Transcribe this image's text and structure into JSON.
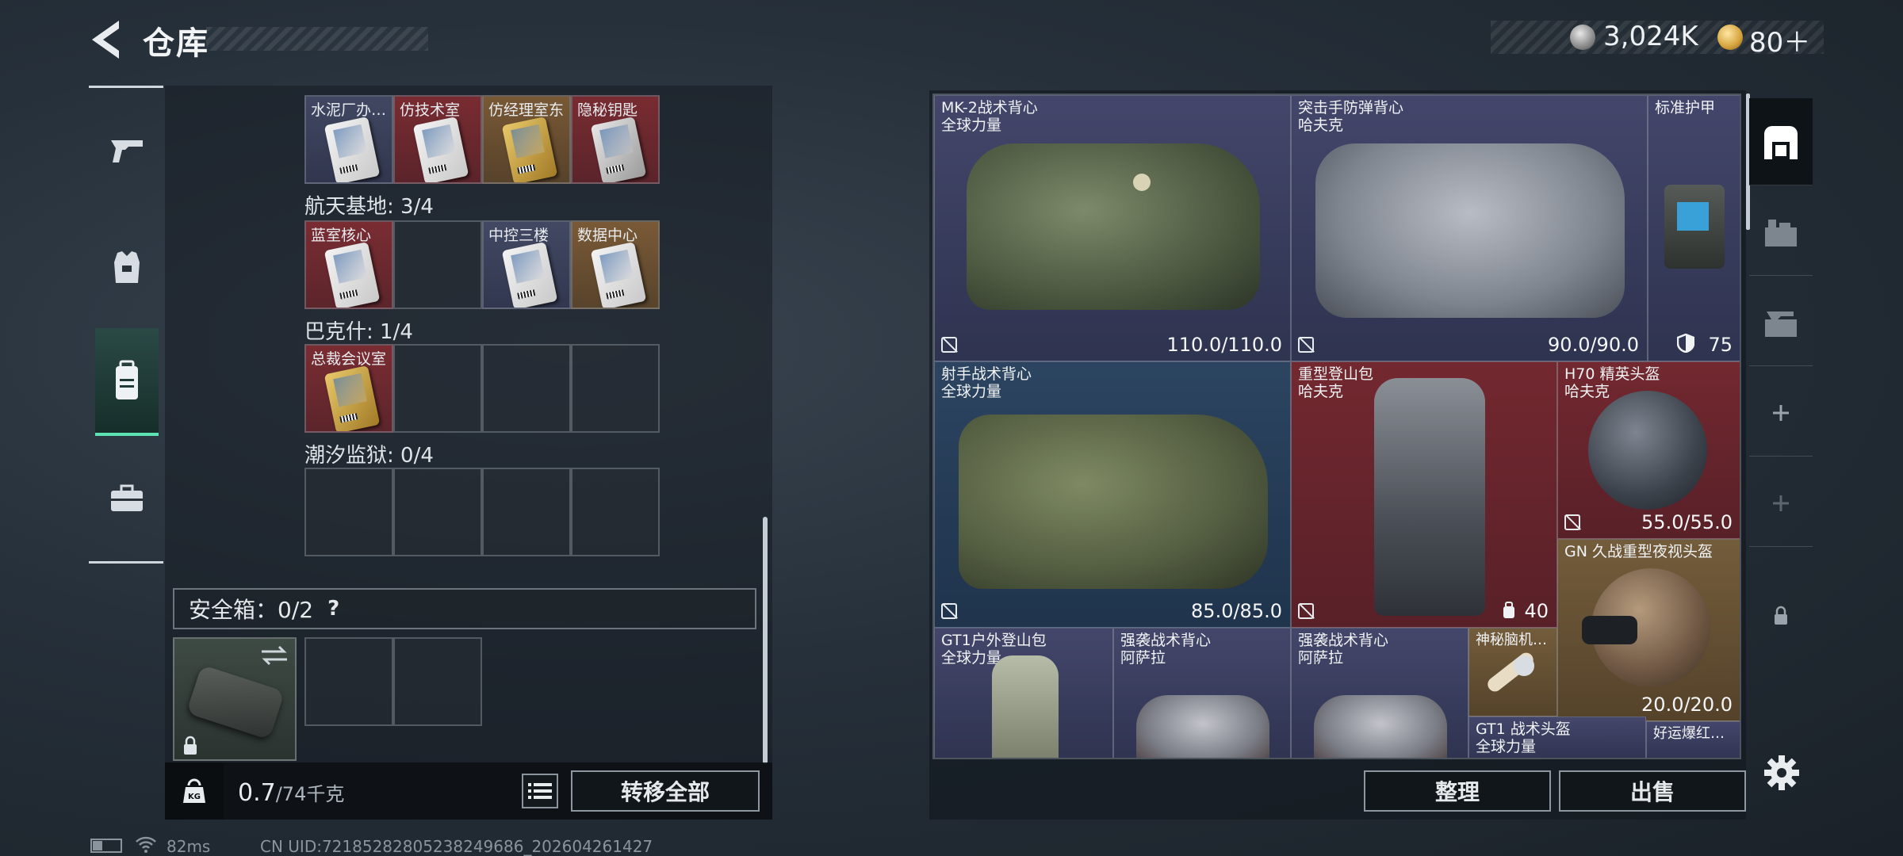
{
  "header": {
    "title": "仓库",
    "currency_silver": "3,024K",
    "currency_gold": "80＋"
  },
  "left_nav": {
    "items": [
      "weapon",
      "armor",
      "backpack",
      "toolbox"
    ],
    "active": "backpack"
  },
  "keycard_sections": [
    {
      "label": "",
      "cells": [
        {
          "label": "水泥厂办…",
          "rarity": "purple"
        },
        {
          "label": "仿技术室",
          "rarity": "red"
        },
        {
          "label": "仿经理室东",
          "rarity": "gold"
        },
        {
          "label": "隐秘钥匙",
          "rarity": "red"
        }
      ]
    },
    {
      "label": "航天基地: 3/4",
      "cells": [
        {
          "label": "蓝室核心",
          "rarity": "red"
        },
        {
          "label": "",
          "rarity": "empty"
        },
        {
          "label": "中控三楼",
          "rarity": "purple"
        },
        {
          "label": "数据中心",
          "rarity": "gold"
        }
      ]
    },
    {
      "label": "巴克什: 1/4",
      "cells": [
        {
          "label": "总裁会议室",
          "rarity": "red"
        },
        {
          "label": "",
          "rarity": "empty"
        },
        {
          "label": "",
          "rarity": "empty"
        },
        {
          "label": "",
          "rarity": "empty"
        }
      ]
    },
    {
      "label": "潮汐监狱: 0/4",
      "cells": [
        {
          "label": "",
          "rarity": "empty"
        },
        {
          "label": "",
          "rarity": "empty"
        },
        {
          "label": "",
          "rarity": "empty"
        },
        {
          "label": "",
          "rarity": "empty"
        }
      ]
    }
  ],
  "safe_box": {
    "label": "安全箱：0/2",
    "help": "?"
  },
  "capacity": {
    "current": "0.7",
    "max": "/74千克",
    "icon_label": "KG"
  },
  "buttons": {
    "transfer_all": "转移全部",
    "sort": "整理",
    "sell": "出售"
  },
  "inventory": {
    "mk2": {
      "name": "MK-2战术背心",
      "sub": "全球力量",
      "durability": "110.0/110.0",
      "rarity": "purple"
    },
    "assault": {
      "name": "突击手防弹背心",
      "sub": "哈夫克",
      "durability": "90.0/90.0",
      "rarity": "purple"
    },
    "plate": {
      "name": "标准护甲",
      "sub": "",
      "value": "75",
      "rarity": "purple"
    },
    "shooter": {
      "name": "射手战术背心",
      "sub": "全球力量",
      "durability": "85.0/85.0",
      "rarity": "blue"
    },
    "heavy_pack": {
      "name": "重型登山包",
      "sub": "哈夫克",
      "value": "40",
      "rarity": "red"
    },
    "h70": {
      "name": "H70 精英头盔",
      "sub": "哈夫克",
      "durability": "55.0/55.0",
      "rarity": "red"
    },
    "gn": {
      "name": "GN 久战重型夜视头盔",
      "sub": "",
      "durability": "20.0/20.0",
      "rarity": "gold"
    },
    "gt1_pack": {
      "name": "GT1户外登山包",
      "sub": "全球力量",
      "rarity": "purple"
    },
    "raid1": {
      "name": "强袭战术背心",
      "sub": "阿萨拉",
      "rarity": "purple"
    },
    "raid2": {
      "name": "强袭战术背心",
      "sub": "阿萨拉",
      "rarity": "purple"
    },
    "mystery": {
      "name": "神秘脑机…",
      "sub": "",
      "rarity": "gold"
    },
    "gt1_helmet": {
      "name": "GT1 战术头盔",
      "sub": "全球力量",
      "rarity": "purple"
    },
    "lucky": {
      "name": "好运爆红…",
      "sub": "",
      "rarity": "purple"
    }
  },
  "status": {
    "ping": "82ms",
    "uid": "CN UID:7218528280523824968​6_202604261427"
  }
}
